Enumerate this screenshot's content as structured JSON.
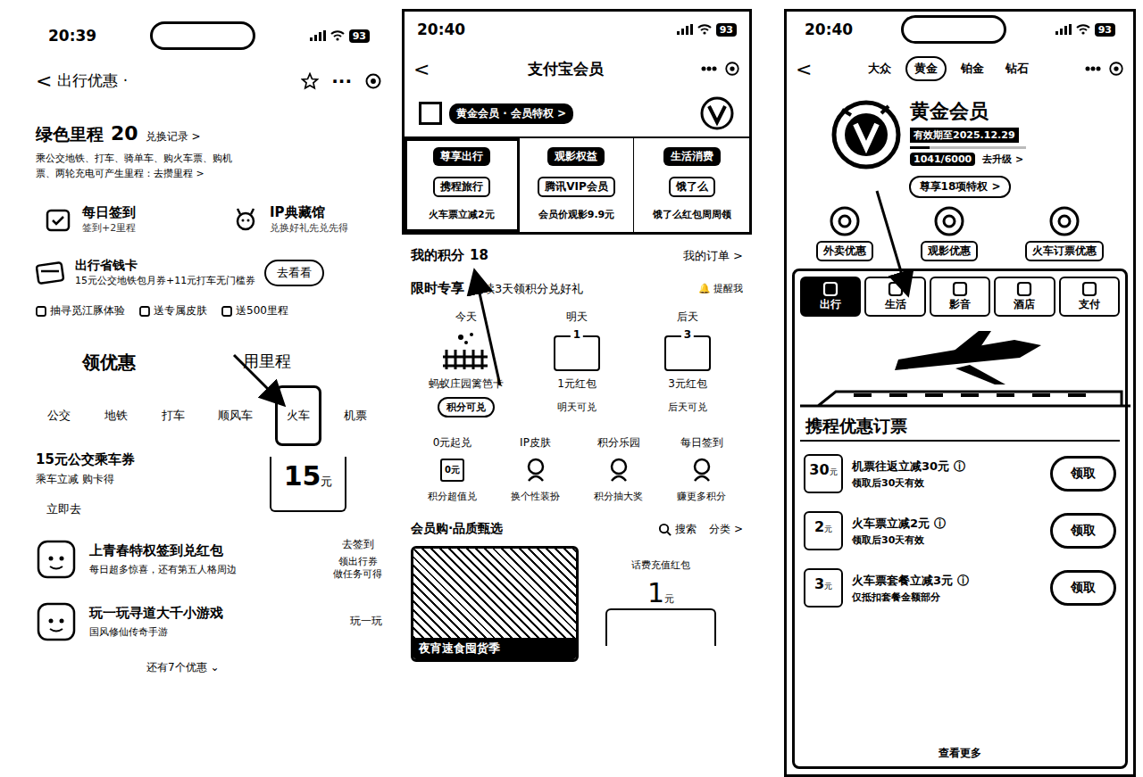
{
  "screen_left": {
    "status": {
      "time": "20:39",
      "battery": "93"
    },
    "nav": {
      "back": "<",
      "title": "出行优惠 ·",
      "more": "···"
    },
    "mileage": {
      "label": "绿色里程",
      "value": "20",
      "link": "兑换记录 >",
      "desc": "乘公交地铁、打车、骑单车、购火车票、购机票、两轮充电可产生里程：去攒里程 >"
    },
    "tasks": [
      {
        "title": "每日签到",
        "sub": "签到+2里程"
      },
      {
        "title": "IP典藏馆",
        "sub": "兑换好礼先兑先得"
      }
    ],
    "card": {
      "title": "出行省钱卡",
      "desc": "15元公交地铁包月券+11元打车无门槛券",
      "button": "去看看",
      "perks": [
        "抽寻觅江豚体验",
        "送专属皮肤",
        "送500里程"
      ]
    },
    "tabs": [
      {
        "label": "领优惠",
        "selected": true
      },
      {
        "label": "用里程",
        "selected": false
      }
    ],
    "categories": [
      {
        "label": "公交",
        "selected": false
      },
      {
        "label": "地铁",
        "selected": false
      },
      {
        "label": "打车",
        "selected": false
      },
      {
        "label": "顺风车",
        "selected": false
      },
      {
        "label": "火车",
        "selected": true
      },
      {
        "label": "机票",
        "selected": false
      }
    ],
    "coupon": {
      "title": "15元公交乘车券",
      "desc": "乘车立减 购卡得",
      "link": "立即去",
      "amount": "15",
      "unit": "元"
    },
    "rows": [
      {
        "title": "上青春特权签到兑红包",
        "desc": "每日超多惊喜，还有第五人格周边",
        "action": "去签到",
        "tip": [
          "领出行券",
          "做任务可得"
        ]
      },
      {
        "title": "玩一玩寻道大千小游戏",
        "desc": "国风修仙传奇手游",
        "action": "玩一玩",
        "tip": []
      }
    ],
    "more": "还有7个优惠 ⌄"
  },
  "screen_middle": {
    "status": {
      "time": "20:40",
      "battery": "93"
    },
    "nav": {
      "back": "<",
      "title": "支付宝会员"
    },
    "member": {
      "label": "黄金会员 · 会员特权 >"
    },
    "benefits": [
      {
        "head": "尊享出行",
        "brand": "携程旅行",
        "desc": "火车票立减2元",
        "selected": true
      },
      {
        "head": "观影权益",
        "brand": "腾讯VIP会员",
        "desc": "会员价观影9.9元",
        "selected": false
      },
      {
        "head": "生活消费",
        "brand": "饿了么",
        "desc": "饿了么红包周周领",
        "selected": false
      }
    ],
    "points": {
      "label": "我的积分",
      "value": "18",
      "orders": "我的订单 >"
    },
    "streak": {
      "title": "限时专享",
      "desc": "连续3天领积分兑好礼",
      "remind": "提醒我",
      "days": [
        {
          "day": "今天",
          "kind": "gift",
          "badge": "",
          "prize": "蚂蚁庄园篱笆卡",
          "action": "积分可兑",
          "button": true
        },
        {
          "day": "明天",
          "kind": "envelope",
          "badge": "1",
          "prize": "1元红包",
          "action": "明天可兑",
          "button": false
        },
        {
          "day": "后天",
          "kind": "envelope",
          "badge": "3",
          "prize": "3元红包",
          "action": "后天可兑",
          "button": false
        }
      ]
    },
    "tools": [
      {
        "title": "0元起兑",
        "sub": "积分超值兑",
        "badge": "0元"
      },
      {
        "title": "IP皮肤",
        "sub": "换个性装扮",
        "badge": ""
      },
      {
        "title": "积分乐园",
        "sub": "积分抽大奖",
        "badge": ""
      },
      {
        "title": "每日签到",
        "sub": "赚更多积分",
        "badge": ""
      }
    ],
    "shop": {
      "title": "会员购·品质甄选",
      "search": "搜索",
      "category": "分类 >",
      "photo_label": "夜宵速食囤货季",
      "packet_label": "话费充值红包",
      "packet_amount": "1",
      "packet_unit": "元"
    }
  },
  "screen_right": {
    "status": {
      "time": "20:40",
      "battery": "93"
    },
    "nav": {
      "back": "<"
    },
    "levels": [
      {
        "label": "大众",
        "selected": false
      },
      {
        "label": "黄金",
        "selected": true
      },
      {
        "label": "铂金",
        "selected": false
      },
      {
        "label": "钻石",
        "selected": false
      }
    ],
    "member": {
      "title": "黄金会员",
      "expiry": "有效期至2025.12.29",
      "progress": "1041/6000",
      "level": 0.17,
      "upgrade": "去升级 >"
    },
    "privileges": {
      "label": "尊享18项特权 >",
      "items": [
        "外卖优惠",
        "观影优惠",
        "火车订票优惠"
      ]
    },
    "categories": [
      {
        "label": "出行",
        "selected": true
      },
      {
        "label": "生活",
        "selected": false
      },
      {
        "label": "影音",
        "selected": false
      },
      {
        "label": "酒店",
        "selected": false
      },
      {
        "label": "支付",
        "selected": false
      }
    ],
    "banner": {
      "title": "携程优惠订票"
    },
    "coupons": [
      {
        "amount": "30",
        "unit": "元",
        "title": "机票往返立减30元",
        "note": "领取后30天有效",
        "button": "领取"
      },
      {
        "amount": "2",
        "unit": "元",
        "title": "火车票立减2元",
        "note": "领取后30天有效",
        "button": "领取"
      },
      {
        "amount": "3",
        "unit": "元",
        "title": "火车票套餐立减3元",
        "note": "仅抵扣套餐金额部分",
        "button": "领取"
      }
    ],
    "more": "查看更多"
  }
}
